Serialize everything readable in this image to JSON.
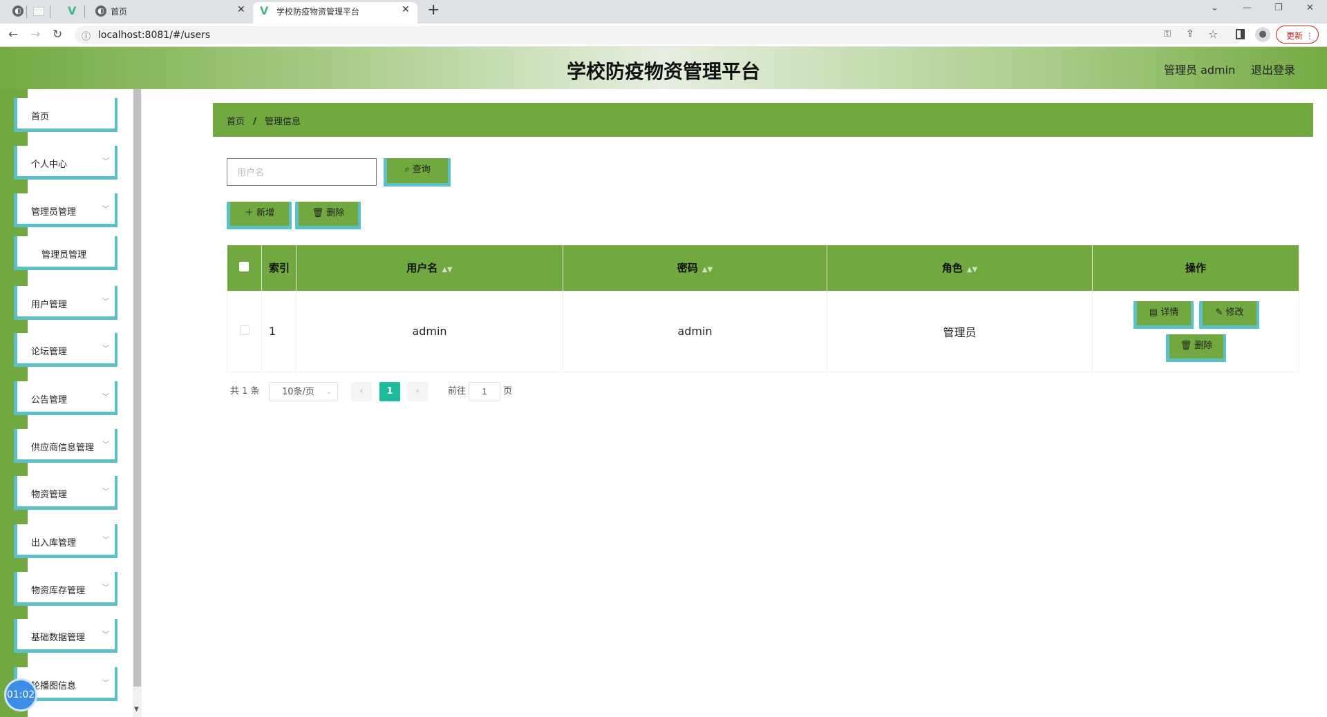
{
  "browser": {
    "tabs": [
      {
        "label": "首页"
      },
      {
        "label": "学校防疫物资管理平台"
      }
    ],
    "url": "localhost:8081/#/users",
    "update_label": "更新"
  },
  "header": {
    "title": "学校防疫物资管理平台",
    "user": "管理员 admin",
    "logout": "退出登录"
  },
  "sidebar": {
    "items": [
      {
        "label": "首页"
      },
      {
        "label": "个人中心"
      },
      {
        "label": "管理员管理"
      },
      {
        "label": "管理员管理"
      },
      {
        "label": "用户管理"
      },
      {
        "label": "论坛管理"
      },
      {
        "label": "公告管理"
      },
      {
        "label": "供应商信息管理"
      },
      {
        "label": "物资管理"
      },
      {
        "label": "出入库管理"
      },
      {
        "label": "物资库存管理"
      },
      {
        "label": "基础数据管理"
      },
      {
        "label": "轮播图信息"
      }
    ]
  },
  "timer": "01:02",
  "breadcrumb": {
    "home": "首页",
    "sep": "/",
    "current": "管理信息"
  },
  "search": {
    "placeholder": "用户名",
    "button": "查询"
  },
  "toolbar": {
    "add": "新增",
    "delete": "删除"
  },
  "table": {
    "headers": {
      "index": "索引",
      "username": "用户名",
      "password": "密码",
      "role": "角色",
      "ops": "操作"
    },
    "rows": [
      {
        "index": "1",
        "username": "admin",
        "password": "admin",
        "role": "管理员"
      }
    ],
    "actions": {
      "detail": "详情",
      "edit": "修改",
      "delete": "删除"
    }
  },
  "pagination": {
    "total": "共 1 条",
    "page_size": "10条/页",
    "current": "1",
    "goto": "前往",
    "goto_value": "1",
    "page_suffix": "页"
  },
  "colors": {
    "green": "#71a840",
    "teal": "#5bc0c8"
  }
}
